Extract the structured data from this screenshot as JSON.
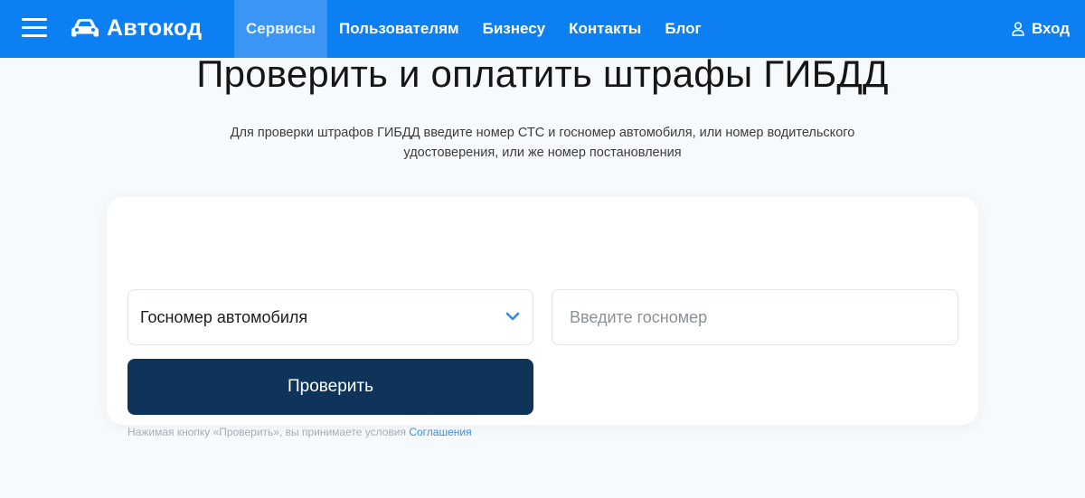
{
  "header": {
    "brand": "Автокод",
    "nav": [
      {
        "label": "Сервисы",
        "active": true
      },
      {
        "label": "Пользователям",
        "active": false
      },
      {
        "label": "Бизнесу",
        "active": false
      },
      {
        "label": "Контакты",
        "active": false
      },
      {
        "label": "Блог",
        "active": false
      }
    ],
    "login_label": "Вход"
  },
  "main": {
    "title": "Проверить и оплатить штрафы ГИБДД",
    "subtitle_line1": "Для проверки штрафов ГИБДД введите номер СТС и госномер автомобиля, или номер водительского",
    "subtitle_line2": "удостоверения, или же номер постановления"
  },
  "form": {
    "select_value": "Госномер автомобиля",
    "input_placeholder": "Введите госномер",
    "input_value": "",
    "submit_label": "Проверить",
    "terms_text": "Нажимая кнопку «Проверить», вы принимаете условия",
    "terms_link": "Соглашения"
  },
  "colors": {
    "header_bg": "#0c7ff2",
    "nav_active_bg": "#3a95f4",
    "submit_bg": "#0e3459",
    "link": "#3d8ede",
    "chevron": "#2f8be6"
  },
  "icons": {
    "menu": "hamburger-menu-icon",
    "brand": "car-icon",
    "login": "user-icon",
    "select": "chevron-down-icon"
  }
}
